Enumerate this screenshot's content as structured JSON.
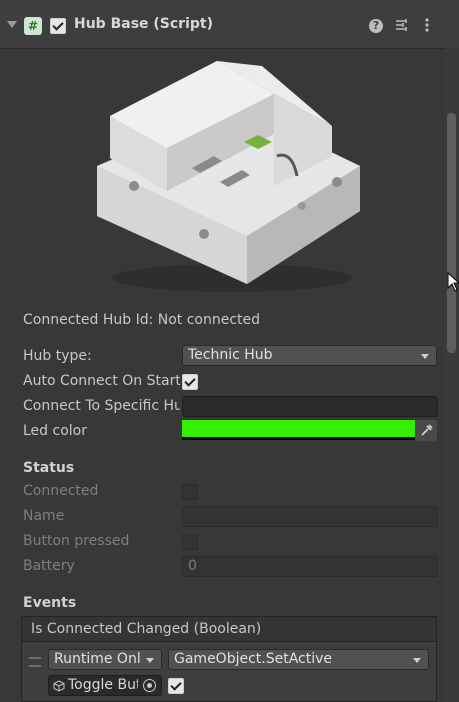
{
  "component": {
    "title": "Hub Base (Script)",
    "enabled": true,
    "icons": [
      "fold-arrow-icon",
      "script-icon",
      "help-icon",
      "preset-icon",
      "more-options-icon"
    ]
  },
  "status_line": "Connected Hub Id: Not connected",
  "fields": {
    "hub_type_label": "Hub type:",
    "hub_type_value": "Technic Hub",
    "auto_connect_label": "Auto Connect On Start",
    "auto_connect_checked": true,
    "specific_hub_label": "Connect To Specific Hub",
    "specific_hub_value": "",
    "led_color_label": "Led color",
    "led_color_hex": "#33f000"
  },
  "status": {
    "heading": "Status",
    "connected_label": "Connected",
    "connected_checked": false,
    "name_label": "Name",
    "name_value": "",
    "button_label": "Button pressed",
    "button_checked": false,
    "battery_label": "Battery",
    "battery_value": "0"
  },
  "events": {
    "heading": "Events",
    "event_title": "Is Connected Changed (Boolean)",
    "runtime_value": "Runtime Only",
    "function_value": "GameObject.SetActive",
    "object_value": "Toggle Button",
    "bool_checked": true
  }
}
